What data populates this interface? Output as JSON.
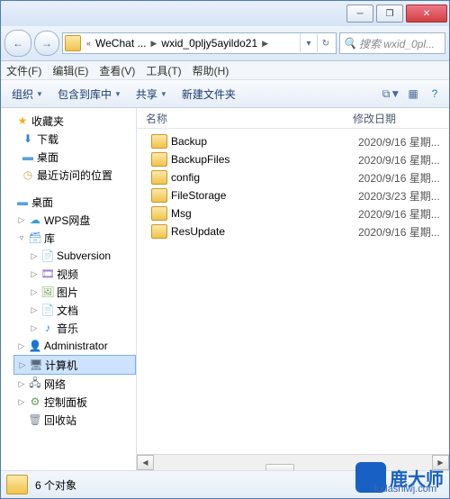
{
  "window": {
    "minimize": "─",
    "maximize": "❐",
    "close": "✕"
  },
  "address": {
    "seg1": "WeChat ...",
    "seg2": "wxid_0pljy5ayildo21",
    "refresh": "↻"
  },
  "search": {
    "placeholder": "搜索 wxid_0pl..."
  },
  "menu": {
    "file": "文件(F)",
    "edit": "编辑(E)",
    "view": "查看(V)",
    "tools": "工具(T)",
    "help": "帮助(H)"
  },
  "toolbar": {
    "organize": "组织",
    "include": "包含到库中",
    "share": "共享",
    "newfolder": "新建文件夹"
  },
  "columns": {
    "name": "名称",
    "modified": "修改日期"
  },
  "tree": {
    "favorites": "收藏夹",
    "downloads": "下载",
    "desktop": "桌面",
    "recent": "最近访问的位置",
    "desktop2": "桌面",
    "wps": "WPS网盘",
    "libraries": "库",
    "subversion": "Subversion",
    "videos": "视频",
    "pictures": "图片",
    "documents": "文档",
    "music": "音乐",
    "administrator": "Administrator",
    "computer": "计算机",
    "network": "网络",
    "controlpanel": "控制面板",
    "recyclebin": "回收站"
  },
  "files": [
    {
      "name": "Backup",
      "date": "2020/9/16 星期..."
    },
    {
      "name": "BackupFiles",
      "date": "2020/9/16 星期..."
    },
    {
      "name": "config",
      "date": "2020/9/16 星期..."
    },
    {
      "name": "FileStorage",
      "date": "2020/3/23 星期..."
    },
    {
      "name": "Msg",
      "date": "2020/9/16 星期..."
    },
    {
      "name": "ResUpdate",
      "date": "2020/9/16 星期..."
    }
  ],
  "status": {
    "count": "6 个对象"
  },
  "brand": {
    "text": "鹿大师",
    "domain": "ludashiwj.com"
  }
}
